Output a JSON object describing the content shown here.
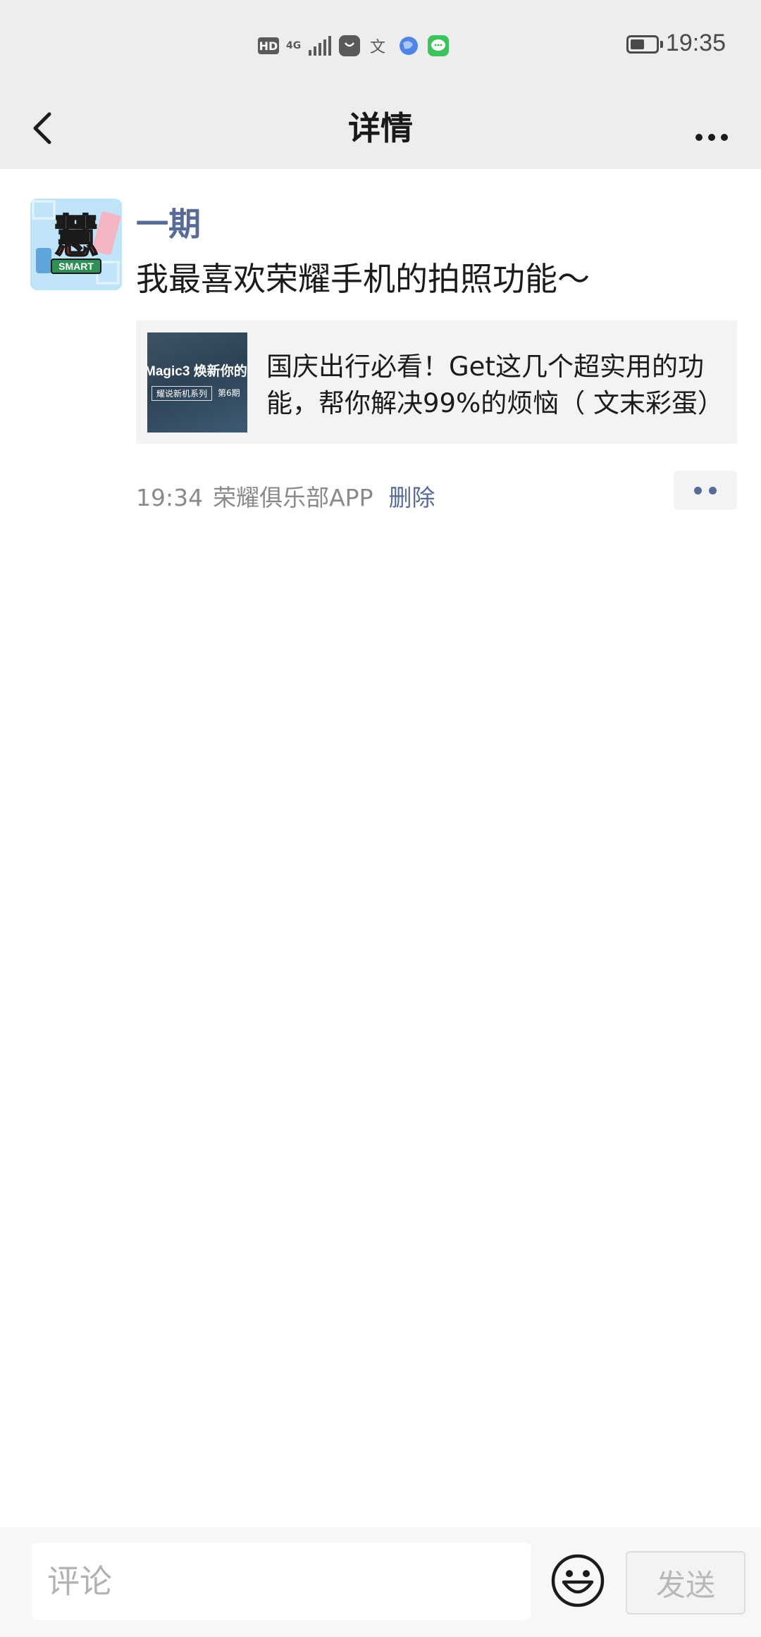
{
  "status_bar": {
    "time": "19:35",
    "hd_label": "HD",
    "network_label": "4G",
    "battery_level": 0.55,
    "notification_icons": [
      "shopping-bag-icon",
      "translate-icon",
      "browser-icon",
      "message-icon"
    ]
  },
  "nav": {
    "title": "详情",
    "back_icon": "chevron-left-icon",
    "more_icon": "more-dots-icon"
  },
  "post": {
    "username": "一期",
    "avatar_text": "慧",
    "avatar_sub": "SMART",
    "text": "我最喜欢荣耀手机的拍照功能～",
    "link": {
      "title": "国庆出行必看！Get这几个超实用的功能，帮你解决99%的烦恼（ 文末彩蛋）",
      "thumb_title": "Magic3 焕新你的",
      "thumb_tag": "耀说新机系列",
      "thumb_issue": "第6期"
    },
    "time": "19:34",
    "source": "荣耀俱乐部APP",
    "delete_label": "删除"
  },
  "comment_bar": {
    "placeholder": "评论",
    "send_label": "发送",
    "emoji_icon": "smiley-icon"
  },
  "colors": {
    "link_blue": "#576b95",
    "bar_bg": "#ededed",
    "card_bg": "#f3f3f5"
  }
}
